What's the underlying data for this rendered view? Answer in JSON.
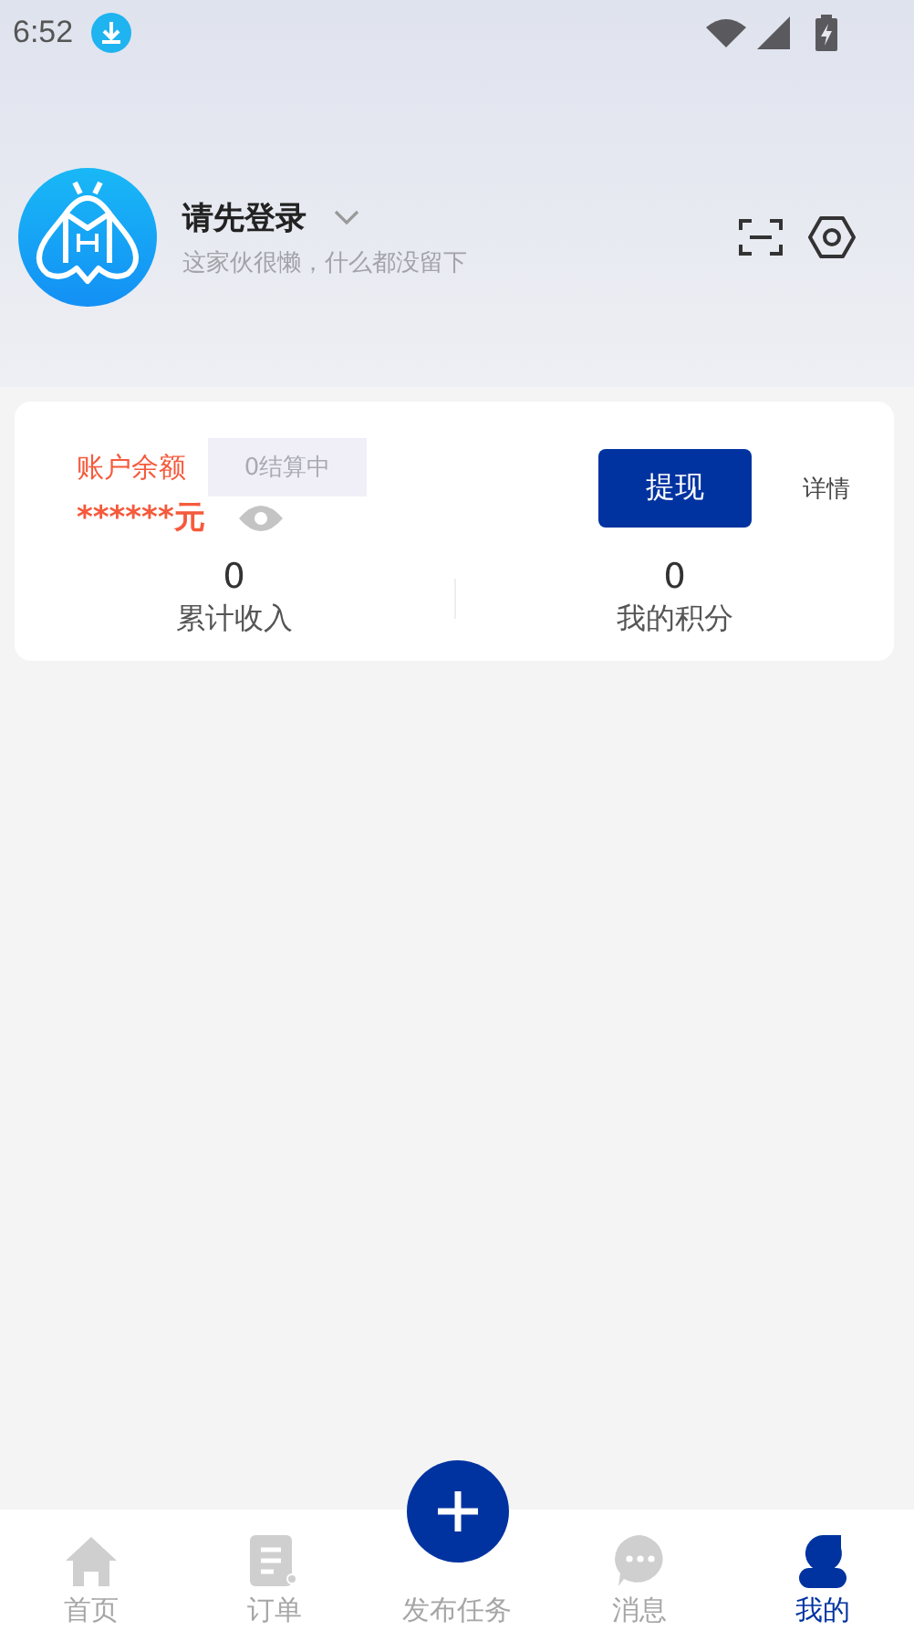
{
  "status_bar": {
    "time": "6:52"
  },
  "profile": {
    "name": "请先登录",
    "bio": "这家伙很懒，什么都没留下"
  },
  "wallet": {
    "label": "账户余额",
    "settling": "0结算中",
    "balance": "******元",
    "withdraw_button": "提现",
    "details_link": "详情"
  },
  "stats": [
    {
      "value": "0",
      "label": "累计收入"
    },
    {
      "value": "0",
      "label": "我的积分"
    }
  ],
  "tab_bar": [
    {
      "kind": "home",
      "label": "首页",
      "selected": false
    },
    {
      "kind": "orders",
      "label": "订单",
      "selected": false
    },
    {
      "kind": "publish",
      "label": "发布任务",
      "selected": false
    },
    {
      "kind": "messages",
      "label": "消息",
      "selected": false
    },
    {
      "kind": "profile",
      "label": "我的",
      "selected": true
    }
  ]
}
